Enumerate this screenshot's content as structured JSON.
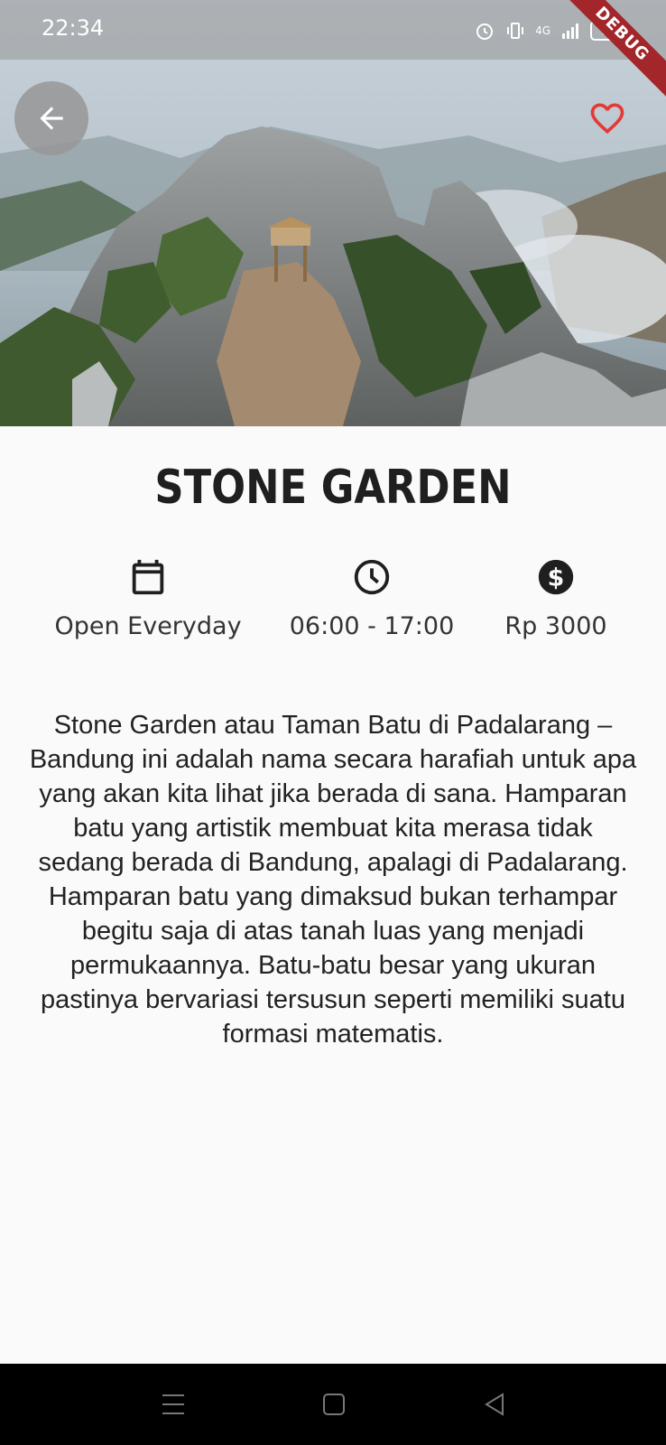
{
  "status_bar": {
    "time": "22:34",
    "battery": "74",
    "network": "4G",
    "debug_label": "DEBUG"
  },
  "hero": {
    "back_icon": "arrow-left-icon",
    "favorite_icon": "heart-outline-icon",
    "favorite_color": "#e53935"
  },
  "place": {
    "name": "STONE GARDEN",
    "info": [
      {
        "icon": "calendar-icon",
        "label": "Open Everyday"
      },
      {
        "icon": "clock-icon",
        "label": "06:00 - 17:00"
      },
      {
        "icon": "dollar-icon",
        "label": "Rp 3000"
      }
    ],
    "description": "Stone Garden atau Taman Batu di Padalarang – Bandung ini adalah nama secara harafiah untuk apa yang akan kita lihat jika berada di sana. Hamparan batu yang artistik membuat kita merasa tidak sedang berada di Bandung, apalagi di Padalarang. Hamparan batu yang dimaksud bukan terhampar begitu saja di atas tanah luas yang menjadi permukaannya. Batu-batu besar yang ukuran pastinya bervariasi tersusun seperti memiliki suatu formasi matematis."
  },
  "nav_bar": {
    "items": [
      "menu-icon",
      "home-square-icon",
      "back-triangle-icon"
    ]
  }
}
